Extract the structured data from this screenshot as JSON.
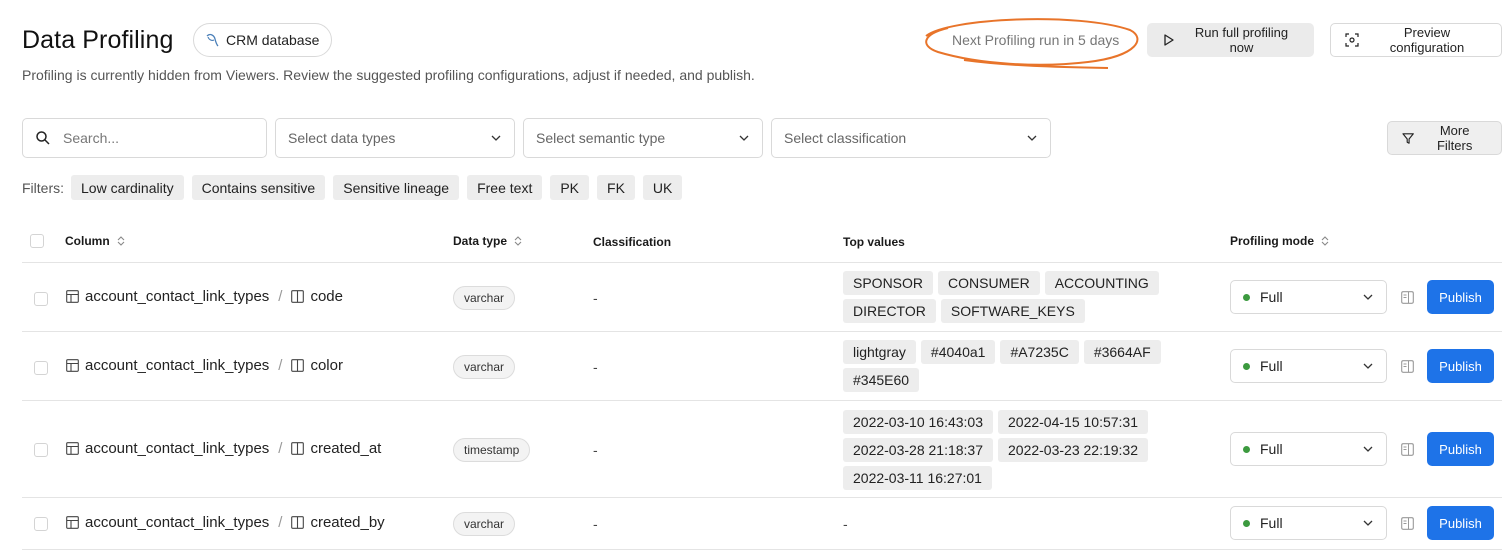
{
  "header": {
    "title": "Data Profiling",
    "database_chip": "CRM database",
    "subtitle": "Profiling is currently hidden from Viewers. Review the suggested profiling configurations, adjust if needed, and publish.",
    "next_run": "Next Profiling run in 5 days",
    "run_button": "Run full profiling now",
    "preview_button": "Preview configuration",
    "annotation_color": "#e8742a"
  },
  "toolbar": {
    "search_placeholder": "Search...",
    "data_types_placeholder": "Select data types",
    "semantic_type_placeholder": "Select semantic type",
    "classification_placeholder": "Select classification",
    "more_filters": "More Filters"
  },
  "filters": {
    "label": "Filters:",
    "chips": [
      "Low cardinality",
      "Contains sensitive",
      "Sensitive lineage",
      "Free text",
      "PK",
      "FK",
      "UK"
    ]
  },
  "table": {
    "columns": {
      "column": "Column",
      "data_type": "Data type",
      "classification": "Classification",
      "top_values": "Top values",
      "profiling_mode": "Profiling mode"
    },
    "rows": [
      {
        "table": "account_contact_link_types",
        "column": "code",
        "data_type": "varchar",
        "classification": "-",
        "top_values": [
          "SPONSOR",
          "CONSUMER",
          "ACCOUNTING",
          "DIRECTOR",
          "SOFTWARE_KEYS"
        ],
        "profiling_mode": "Full",
        "publish": "Publish"
      },
      {
        "table": "account_contact_link_types",
        "column": "color",
        "data_type": "varchar",
        "classification": "-",
        "top_values": [
          "lightgray",
          "#4040a1",
          "#A7235C",
          "#3664AF",
          "#345E60"
        ],
        "profiling_mode": "Full",
        "publish": "Publish"
      },
      {
        "table": "account_contact_link_types",
        "column": "created_at",
        "data_type": "timestamp",
        "classification": "-",
        "top_values": [
          "2022-03-10 16:43:03",
          "2022-04-15 10:57:31",
          "2022-03-28 21:18:37",
          "2022-03-23 22:19:32",
          "2022-03-11 16:27:01"
        ],
        "profiling_mode": "Full",
        "publish": "Publish"
      },
      {
        "table": "account_contact_link_types",
        "column": "created_by",
        "data_type": "varchar",
        "classification": "-",
        "top_values_empty": "-",
        "profiling_mode": "Full",
        "publish": "Publish"
      }
    ]
  }
}
